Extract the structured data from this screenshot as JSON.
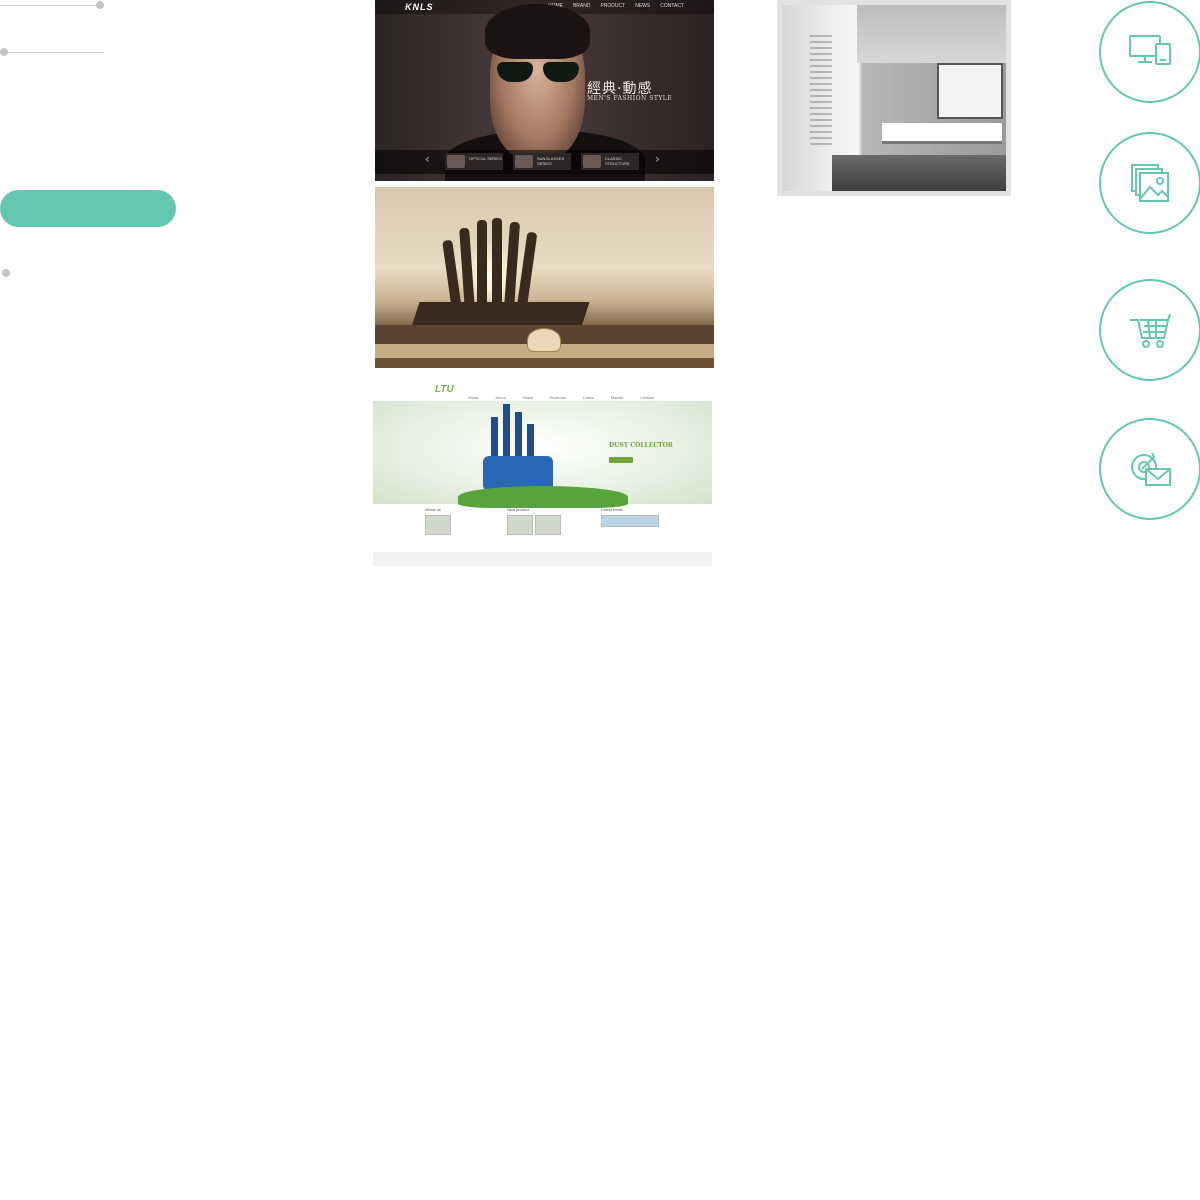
{
  "left_panel": {
    "pill_button_label": ""
  },
  "portfolio": {
    "items": [
      {
        "name": "KNLS",
        "logo_text": "KNLS",
        "nav": [
          "HOME",
          "BRAND",
          "PRODUCT",
          "NEWS",
          "CONTACT"
        ],
        "slogan_cn": "經典·動感",
        "slogan_en": "MEN'S FASHION STYLE",
        "series": [
          "OPTICAL SERIES",
          "SUNGLASSES SERIES",
          "CLASSIC STRUCTURE"
        ]
      },
      {
        "name": "lakeside chair site"
      },
      {
        "name": "LTU",
        "logo_text": "LTU",
        "nav": [
          "Home",
          "About",
          "News",
          "Products",
          "Cases",
          "Market",
          "Contact"
        ],
        "hero_title": "DUST COLLECTOR",
        "sections": [
          "About us",
          "New product",
          "Latest news"
        ]
      },
      {
        "name": "office interior"
      }
    ]
  },
  "services": [
    {
      "icon": "devices-icon"
    },
    {
      "icon": "gallery-icon"
    },
    {
      "icon": "cart-icon"
    },
    {
      "icon": "email-marketing-icon"
    }
  ],
  "colors": {
    "accent": "#66c6b4",
    "line": "#cfcfcf",
    "dot": "#c4c4c4"
  }
}
